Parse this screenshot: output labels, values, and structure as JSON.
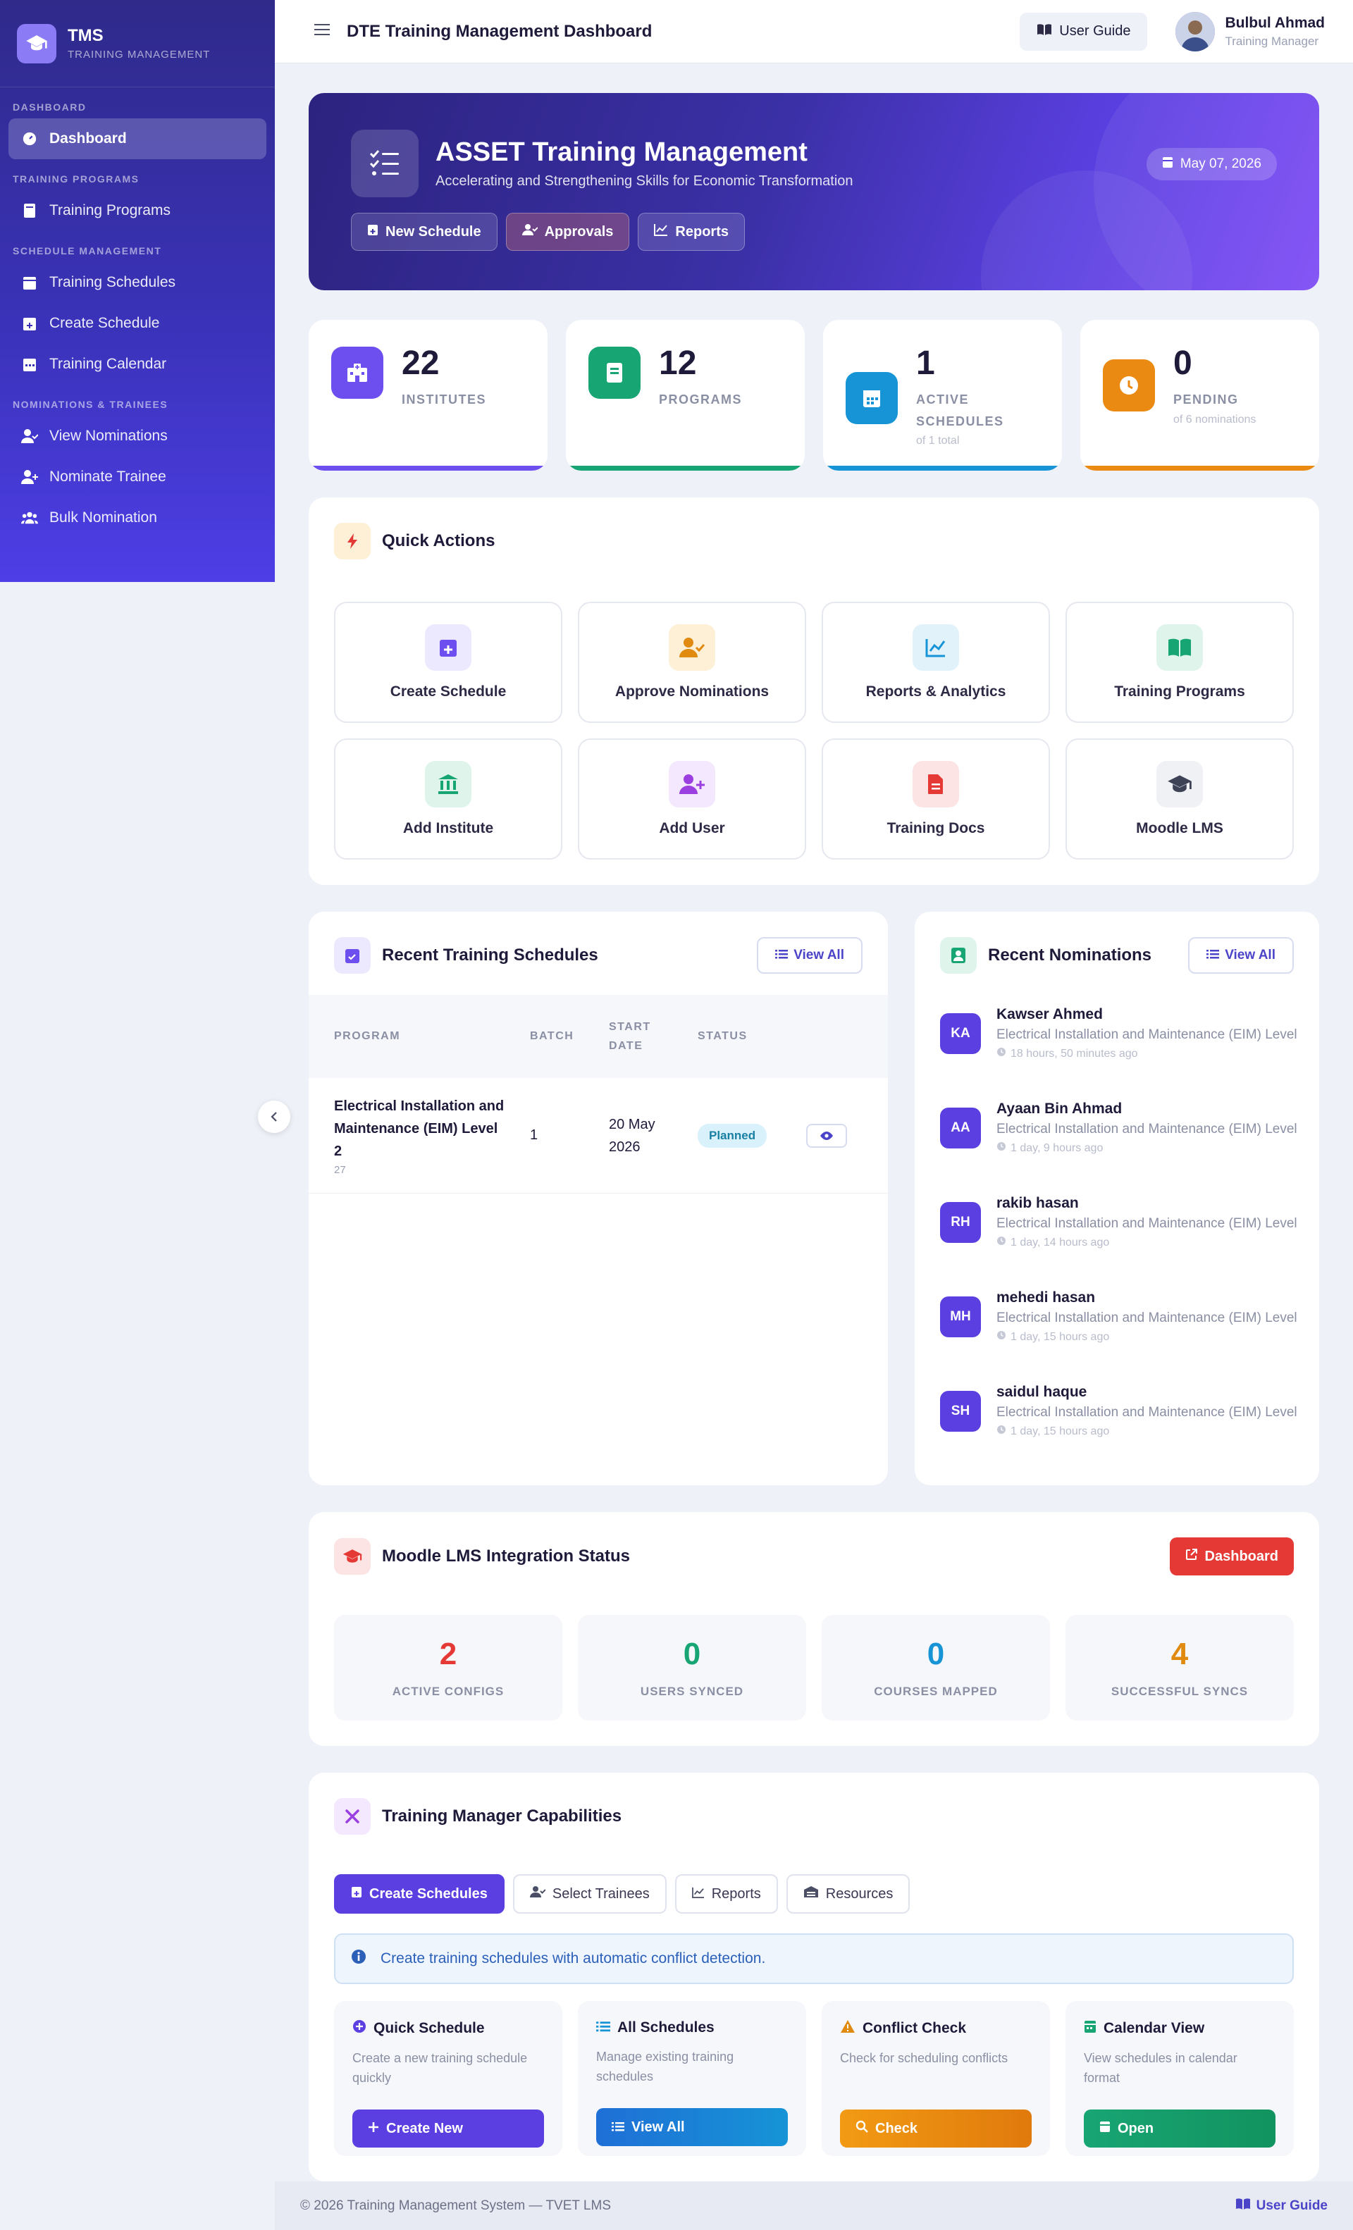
{
  "brand": {
    "title": "TMS",
    "subtitle": "TRAINING MANAGEMENT"
  },
  "sidebar": {
    "sections": [
      {
        "label": "DASHBOARD",
        "items": [
          {
            "label": "Dashboard",
            "icon": "gauge-icon",
            "active": true
          }
        ]
      },
      {
        "label": "TRAINING PROGRAMS",
        "items": [
          {
            "label": "Training Programs",
            "icon": "book-icon"
          }
        ]
      },
      {
        "label": "SCHEDULE MANAGEMENT",
        "items": [
          {
            "label": "Training Schedules",
            "icon": "calendar-icon"
          },
          {
            "label": "Create Schedule",
            "icon": "calendar-plus-icon"
          },
          {
            "label": "Training Calendar",
            "icon": "calendar-grid-icon"
          }
        ]
      },
      {
        "label": "NOMINATIONS & TRAINEES",
        "items": [
          {
            "label": "View Nominations",
            "icon": "user-check-icon"
          },
          {
            "label": "Nominate Trainee",
            "icon": "user-plus-icon"
          },
          {
            "label": "Bulk Nomination",
            "icon": "users-icon"
          }
        ]
      }
    ]
  },
  "header": {
    "title": "DTE Training Management Dashboard",
    "guide_label": "User Guide",
    "user_name": "Bulbul Ahmad",
    "user_role": "Training Manager"
  },
  "hero": {
    "title": "ASSET Training Management",
    "subtitle": "Accelerating and Strengthening Skills for Economic Transformation",
    "date": "May 07, 2026",
    "actions": [
      "New Schedule",
      "Approvals",
      "Reports"
    ]
  },
  "stats": [
    {
      "value": "22",
      "label": "INSTITUTES",
      "note": "",
      "color": "#6d4ff0"
    },
    {
      "value": "12",
      "label": "PROGRAMS",
      "note": "",
      "color": "#18a574"
    },
    {
      "value": "1",
      "label": "ACTIVE SCHEDULES",
      "note": "of 1 total",
      "color": "#1694d6"
    },
    {
      "value": "0",
      "label": "PENDING",
      "note": "of 6 nominations",
      "color": "#eb8a12"
    }
  ],
  "quick_actions": {
    "title": "Quick Actions",
    "items": [
      {
        "label": "Create Schedule",
        "icon": "calendar-plus-icon",
        "color": "#6d4ff0",
        "bg": "#ece8fd"
      },
      {
        "label": "Approve Nominations",
        "icon": "user-check-icon",
        "color": "#e08a10",
        "bg": "#fdf0d6"
      },
      {
        "label": "Reports & Analytics",
        "icon": "chart-line-icon",
        "color": "#1694d6",
        "bg": "#e2f2fb"
      },
      {
        "label": "Training Programs",
        "icon": "book-open-icon",
        "color": "#18a574",
        "bg": "#dff5ec"
      },
      {
        "label": "Add Institute",
        "icon": "institution-icon",
        "color": "#18a574",
        "bg": "#dff5ec"
      },
      {
        "label": "Add User",
        "icon": "user-plus-icon",
        "color": "#9b3fe0",
        "bg": "#f3e8fd"
      },
      {
        "label": "Training Docs",
        "icon": "file-icon",
        "color": "#e53935",
        "bg": "#fde4e4"
      },
      {
        "label": "Moodle LMS",
        "icon": "graduation-cap-icon",
        "color": "#3d4257",
        "bg": "#f0f1f5"
      }
    ]
  },
  "schedules": {
    "title": "Recent Training Schedules",
    "view_all": "View All",
    "columns": [
      "PROGRAM",
      "BATCH",
      "START DATE",
      "STATUS"
    ],
    "rows": [
      {
        "program": "Electrical Installation and Maintenance (EIM) Level 2",
        "code": "27",
        "batch": "1",
        "start": "20 May 2026",
        "status": "Planned"
      }
    ]
  },
  "nominations": {
    "title": "Recent Nominations",
    "view_all": "View All",
    "items": [
      {
        "initials": "KA",
        "name": "Kawser Ahmed",
        "program": "Electrical Installation and Maintenance (EIM) Level",
        "time": "18 hours, 50 minutes ago"
      },
      {
        "initials": "AA",
        "name": "Ayaan Bin Ahmad",
        "program": "Electrical Installation and Maintenance (EIM) Level",
        "time": "1 day, 9 hours ago"
      },
      {
        "initials": "RH",
        "name": "rakib hasan",
        "program": "Electrical Installation and Maintenance (EIM) Level",
        "time": "1 day, 14 hours ago"
      },
      {
        "initials": "MH",
        "name": "mehedi hasan",
        "program": "Electrical Installation and Maintenance (EIM) Level",
        "time": "1 day, 15 hours ago"
      },
      {
        "initials": "SH",
        "name": "saidul haque",
        "program": "Electrical Installation and Maintenance (EIM) Level",
        "time": "1 day, 15 hours ago"
      }
    ]
  },
  "moodle": {
    "title": "Moodle LMS Integration Status",
    "button": "Dashboard",
    "stats": [
      {
        "value": "2",
        "label": "ACTIVE CONFIGS",
        "color": "#e53935"
      },
      {
        "value": "0",
        "label": "USERS SYNCED",
        "color": "#18a574"
      },
      {
        "value": "0",
        "label": "COURSES MAPPED",
        "color": "#1694d6"
      },
      {
        "value": "4",
        "label": "SUCCESSFUL SYNCS",
        "color": "#e08a10"
      }
    ]
  },
  "capabilities": {
    "title": "Training Manager Capabilities",
    "tabs": [
      "Create Schedules",
      "Select Trainees",
      "Reports",
      "Resources"
    ],
    "info": "Create training schedules with automatic conflict detection.",
    "items": [
      {
        "title": "Quick Schedule",
        "desc": "Create a new training schedule quickly",
        "button": "Create New",
        "color": "#5b3fe0",
        "icon": "plus-circle-icon"
      },
      {
        "title": "All Schedules",
        "desc": "Manage existing training schedules",
        "button": "View All",
        "color": "#1694d6",
        "icon": "list-icon"
      },
      {
        "title": "Conflict Check",
        "desc": "Check for scheduling conflicts",
        "button": "Check",
        "color": "#eb8a12",
        "icon": "warning-icon"
      },
      {
        "title": "Calendar View",
        "desc": "View schedules in calendar format",
        "button": "Open",
        "color": "#18a574",
        "icon": "calendar-icon"
      }
    ]
  },
  "footer": {
    "text": "© 2026 Training Management System — TVET LMS",
    "guide": "User Guide"
  }
}
